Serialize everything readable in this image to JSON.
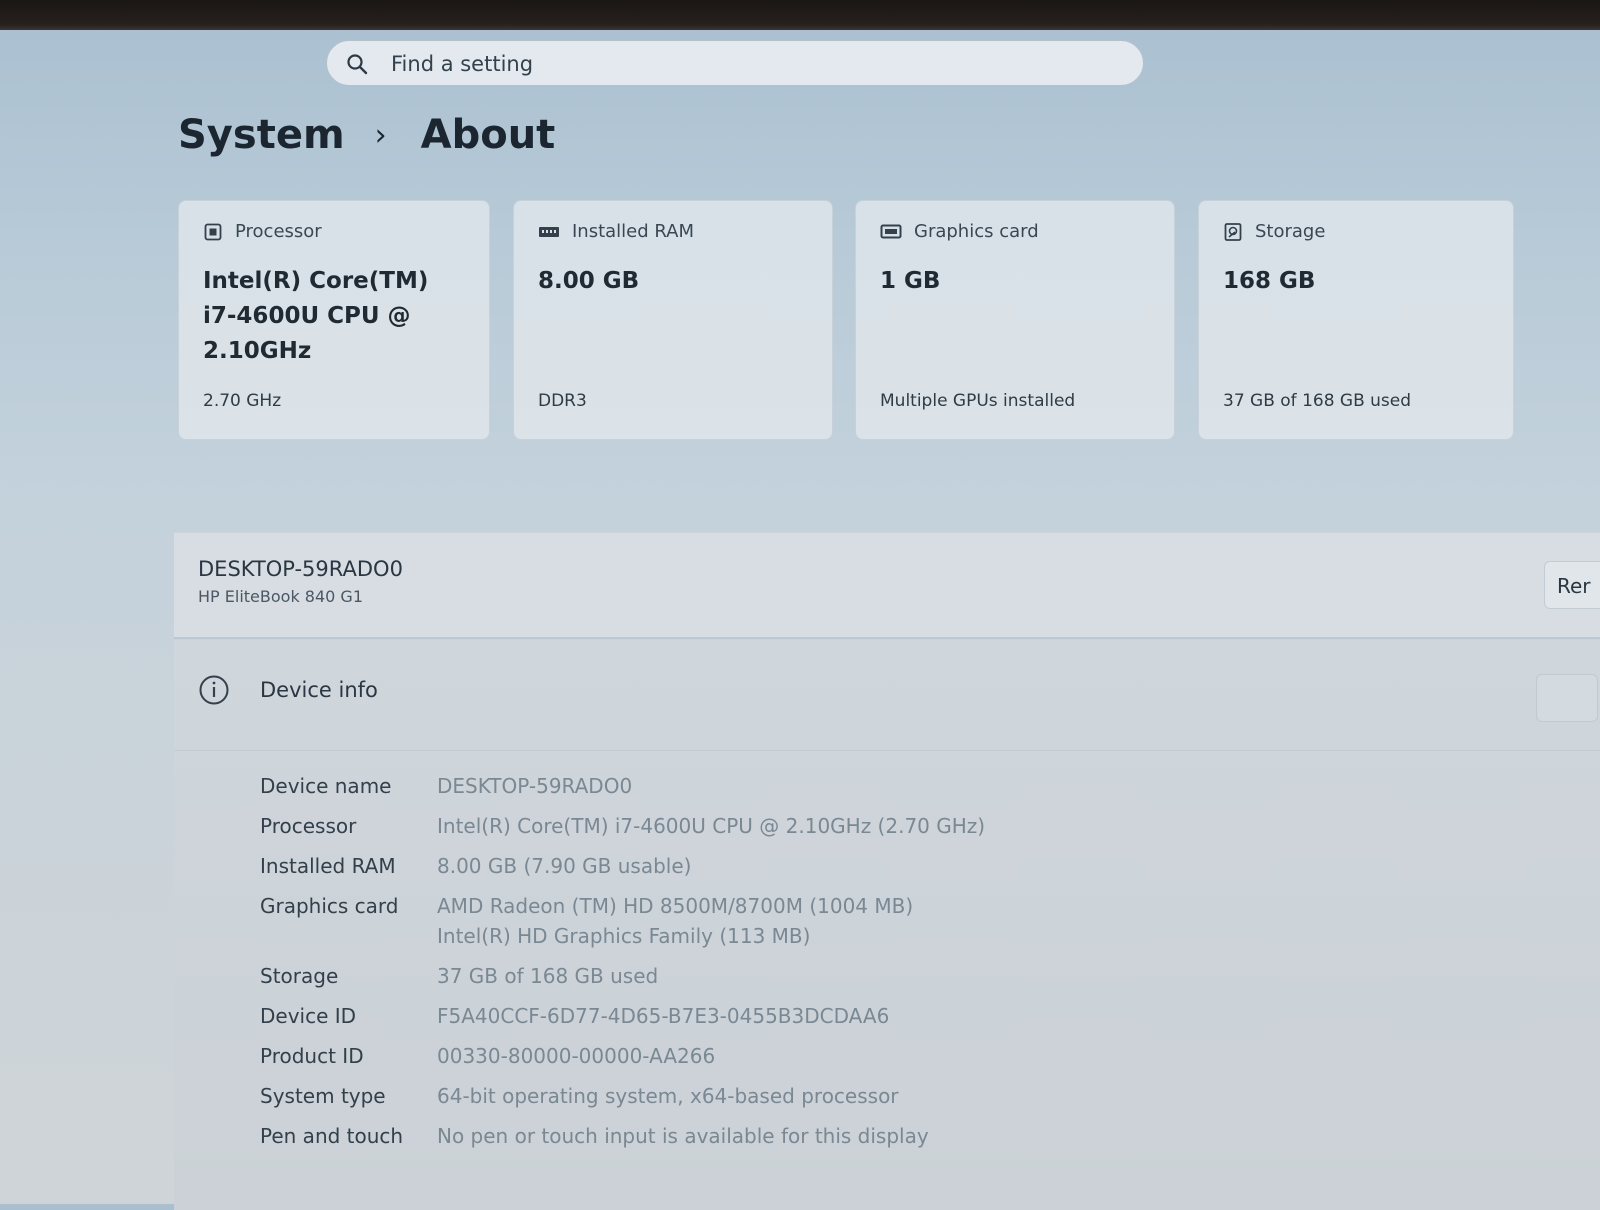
{
  "search": {
    "placeholder": "Find a setting",
    "icon": "search-icon"
  },
  "breadcrumb": {
    "parent": "System",
    "separator": "›",
    "current": "About"
  },
  "cards": [
    {
      "title": "Processor",
      "icon": "processor-icon",
      "value": "Intel(R) Core(TM) i7-4600U CPU @ 2.10GHz",
      "sub": "2.70 GHz"
    },
    {
      "title": "Installed RAM",
      "icon": "memory-icon",
      "value": "8.00 GB",
      "sub": "DDR3"
    },
    {
      "title": "Graphics card",
      "icon": "graphics-card-icon",
      "value": "1 GB",
      "sub": "Multiple GPUs installed"
    },
    {
      "title": "Storage",
      "icon": "storage-icon",
      "value": "168 GB",
      "sub": "37 GB of 168 GB used"
    }
  ],
  "device": {
    "name": "DESKTOP-59RADO0",
    "model": "HP EliteBook 840 G1",
    "rename_label": "Rer"
  },
  "device_info": {
    "title": "Device info",
    "icon": "info-icon",
    "rows": [
      {
        "label": "Device name",
        "value": "DESKTOP-59RADO0"
      },
      {
        "label": "Processor",
        "value": "Intel(R) Core(TM) i7-4600U CPU @ 2.10GHz (2.70 GHz)"
      },
      {
        "label": "Installed RAM",
        "value": "8.00 GB (7.90 GB usable)"
      },
      {
        "label": "Graphics card",
        "value": "AMD Radeon (TM) HD 8500M/8700M (1004 MB)",
        "value2": "Intel(R) HD Graphics Family (113 MB)"
      },
      {
        "label": "Storage",
        "value": "37 GB of 168 GB used"
      },
      {
        "label": "Device ID",
        "value": "F5A40CCF-6D77-4D65-B7E3-0455B3DCDAA6"
      },
      {
        "label": "Product ID",
        "value": "00330-80000-00000-AA266"
      },
      {
        "label": "System type",
        "value": "64-bit operating system, x64-based processor"
      },
      {
        "label": "Pen and touch",
        "value": "No pen or touch input is available for this display"
      }
    ]
  }
}
